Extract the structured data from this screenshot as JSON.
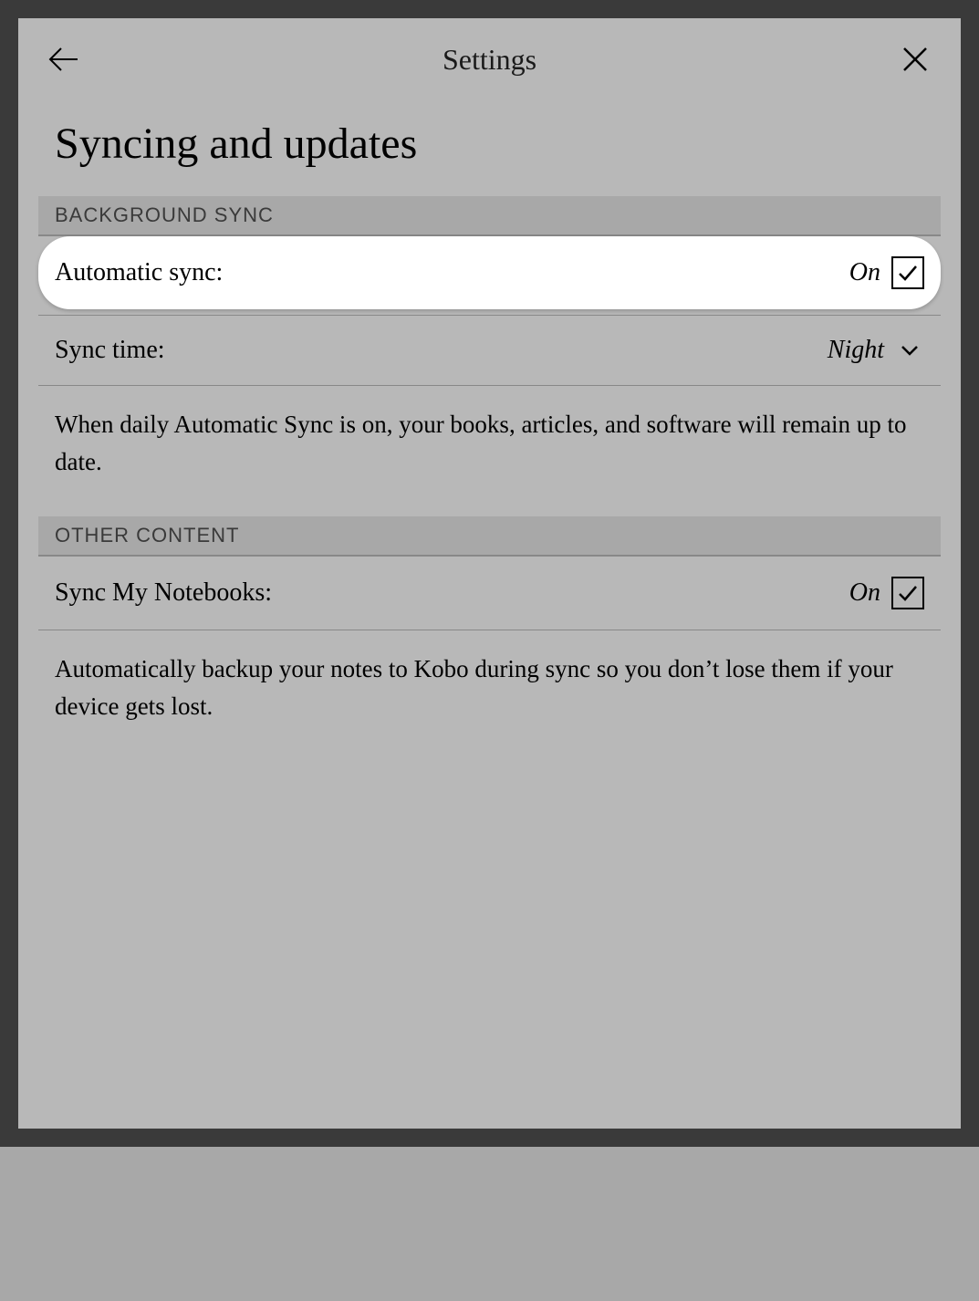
{
  "header": {
    "title": "Settings"
  },
  "page": {
    "title": "Syncing and updates"
  },
  "sections": {
    "background_sync": {
      "header": "BACKGROUND SYNC",
      "automatic_sync": {
        "label": "Automatic sync:",
        "value": "On"
      },
      "sync_time": {
        "label": "Sync time:",
        "value": "Night"
      },
      "description": "When daily Automatic Sync is on, your books, articles, and software will remain up to date."
    },
    "other_content": {
      "header": "OTHER CONTENT",
      "sync_notebooks": {
        "label": "Sync My Notebooks:",
        "value": "On"
      },
      "description": "Automatically backup your notes to Kobo during sync so you don’t lose them if your device gets lost."
    }
  }
}
